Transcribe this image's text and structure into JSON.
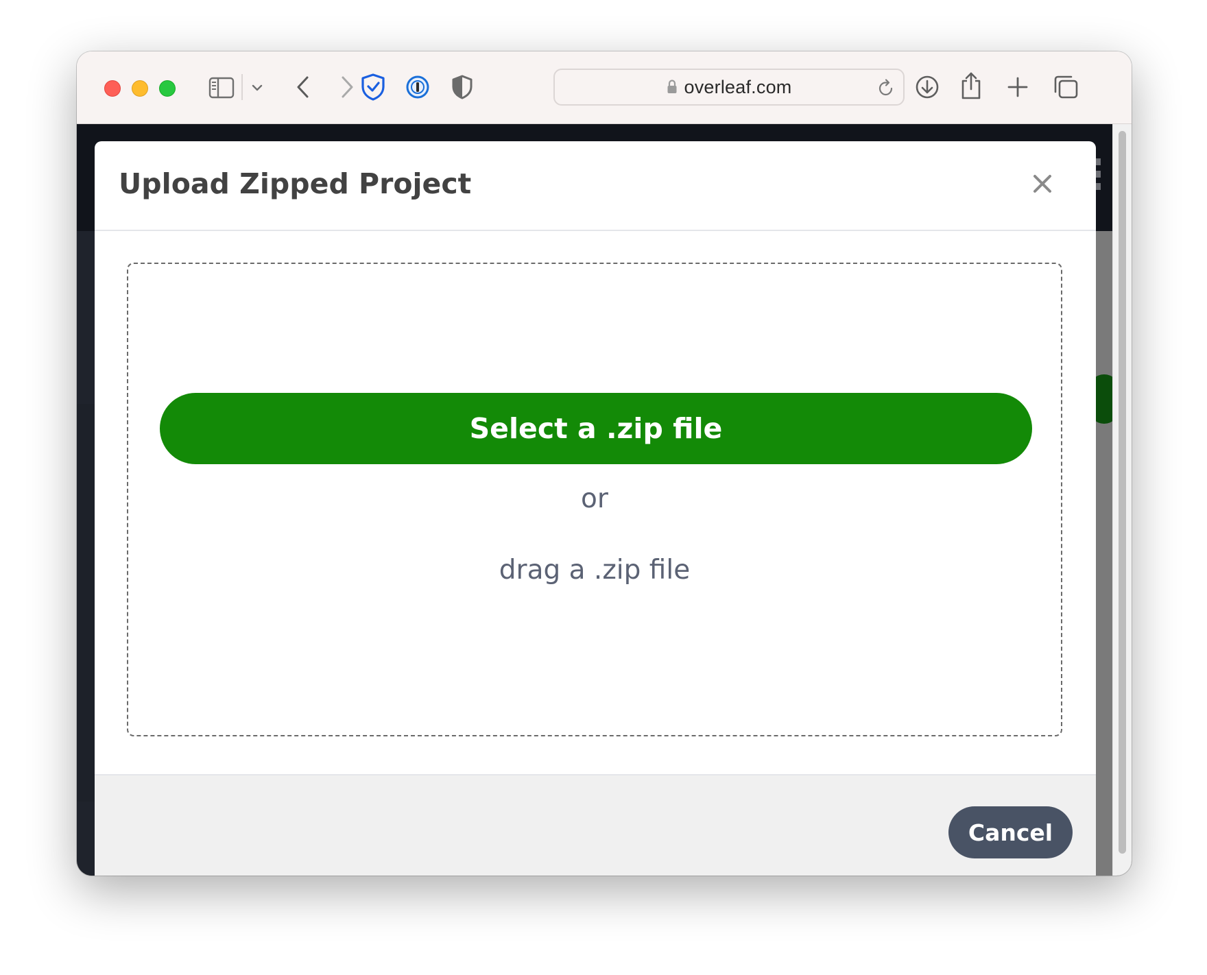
{
  "browser": {
    "url": "overleaf.com",
    "icons": {
      "sidebar_toggle": "sidebar-icon",
      "sidebar_menu": "chevron-down-icon",
      "back": "chevron-left-icon",
      "forward": "chevron-right-icon",
      "extension_1": "shield-check-icon",
      "extension_2": "password-manager-icon",
      "extension_3": "privacy-shield-icon",
      "lock": "lock-icon",
      "reload": "reload-icon",
      "downloads": "download-icon",
      "share": "share-icon",
      "new_tab": "plus-icon",
      "tab_overview": "tabs-icon"
    }
  },
  "modal": {
    "title": "Upload Zipped Project",
    "close_icon": "close-icon",
    "select_button_label": "Select a .zip file",
    "or_text": "or",
    "drag_text": "drag a .zip file",
    "cancel_label": "Cancel"
  },
  "colors": {
    "primary_green": "#138a07",
    "cancel_button": "#495365",
    "title_text": "#424242",
    "secondary_text": "#5b6274"
  }
}
